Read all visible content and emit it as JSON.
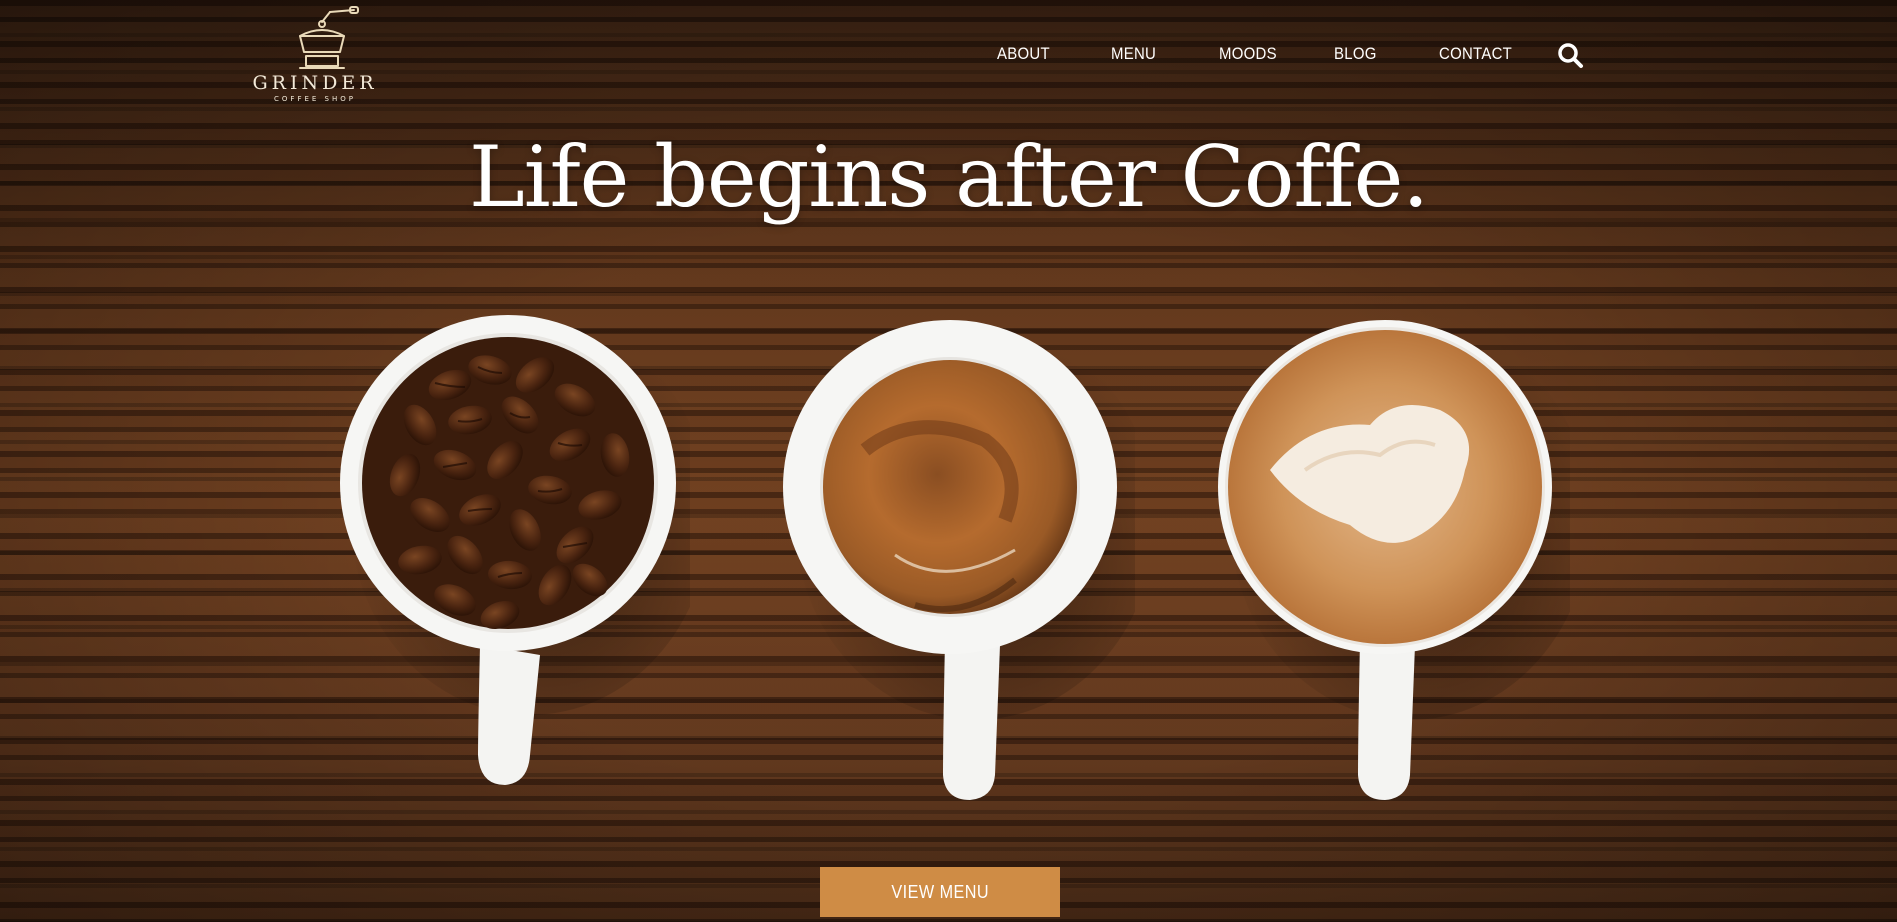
{
  "brand": {
    "name": "GRINDER",
    "tagline": "COFFEE SHOP",
    "logo_icon": "coffee-grinder-icon"
  },
  "nav": {
    "items": [
      {
        "label": "ABOUT"
      },
      {
        "label": "MENU"
      },
      {
        "label": "MOODS"
      },
      {
        "label": "BLOG"
      },
      {
        "label": "CONTACT"
      }
    ],
    "search_icon": "search-icon"
  },
  "hero": {
    "headline": "Life begins after Coffe.",
    "cta_label": "VIEW MENU",
    "images": [
      "cup-of-coffee-beans",
      "cup-of-espresso",
      "cup-of-latte-art"
    ]
  },
  "colors": {
    "accent": "#cf8c45",
    "text": "#ffffff",
    "logo": "#f2e9d8"
  }
}
